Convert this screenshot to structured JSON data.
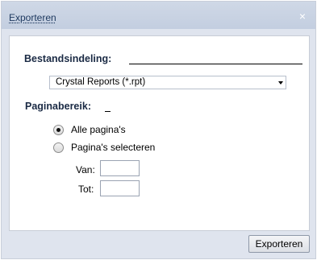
{
  "dialog": {
    "title": "Exporteren",
    "close_glyph": "×",
    "close_icon": "close-icon"
  },
  "format": {
    "label": "Bestandsindeling:",
    "selected": "Crystal Reports (*.rpt)",
    "dropdown_icon": "chevron-down-icon"
  },
  "page_range": {
    "label": "Paginabereik:",
    "options": [
      {
        "label": "Alle pagina's",
        "selected": true
      },
      {
        "label": "Pagina's selecteren",
        "selected": false
      }
    ],
    "from_label": "Van:",
    "to_label": "Tot:",
    "from_value": "",
    "to_value": ""
  },
  "footer": {
    "export_label": "Exporteren"
  }
}
